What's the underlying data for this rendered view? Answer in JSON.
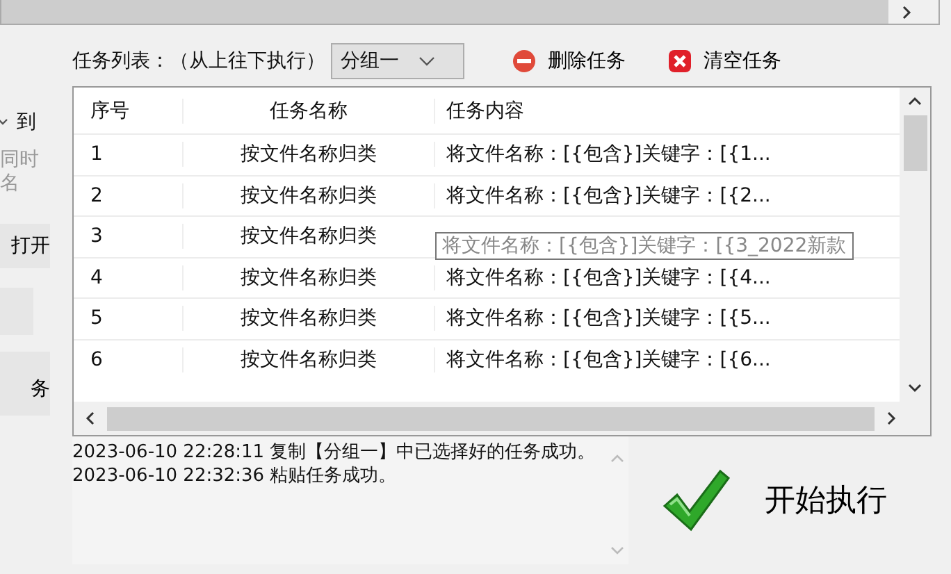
{
  "left_panel": {
    "to_label": "到",
    "hint_lines": [
      "同时",
      "名"
    ],
    "open_button": "打开",
    "task_button": "务"
  },
  "toolbar": {
    "label": "任务列表：（从上往下执行）",
    "group_select": "分组一",
    "delete_button": "删除任务",
    "clear_button": "清空任务"
  },
  "table": {
    "columns": [
      "序号",
      "任务名称",
      "任务内容"
    ],
    "rows": [
      {
        "index": "1",
        "name": "按文件名称归类",
        "content": "将文件名称：[{包含}]关键字：[{1..."
      },
      {
        "index": "2",
        "name": "按文件名称归类",
        "content": "将文件名称：[{包含}]关键字：[{2..."
      },
      {
        "index": "3",
        "name": "按文件名称归类",
        "tooltip": "将文件名称：[{包含}]关键字：[{3_2022新款"
      },
      {
        "index": "4",
        "name": "按文件名称归类",
        "content": "将文件名称：[{包含}]关键字：[{4..."
      },
      {
        "index": "5",
        "name": "按文件名称归类",
        "content": "将文件名称：[{包含}]关键字：[{5..."
      },
      {
        "index": "6",
        "name": "按文件名称归类",
        "content": "将文件名称：[{包含}]关键字：[{6..."
      }
    ]
  },
  "log": {
    "lines": [
      "2023-06-10 22:28:11 复制【分组一】中已选择好的任务成功。",
      "2023-06-10 22:32:36 粘贴任务成功。"
    ]
  },
  "start_button": "开始执行"
}
